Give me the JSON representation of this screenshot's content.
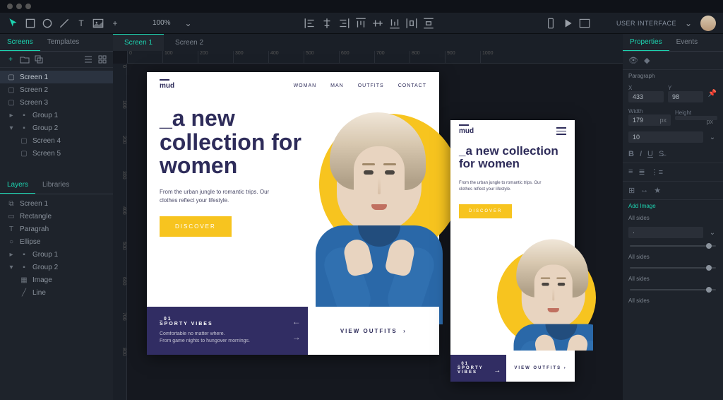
{
  "zoom": "100%",
  "user_label": "USER INTERFACE",
  "screens_panel": {
    "tabs": [
      "Screens",
      "Templates"
    ],
    "items": [
      {
        "label": "Screen 1",
        "selected": true
      },
      {
        "label": "Screen 2"
      },
      {
        "label": "Screen 3"
      },
      {
        "label": "Group 1",
        "folder": true
      },
      {
        "label": "Group 2",
        "folder": true,
        "open": true
      },
      {
        "label": "Screen 4",
        "indent": 1
      },
      {
        "label": "Screen 5",
        "indent": 1
      }
    ]
  },
  "layers_panel": {
    "tabs": [
      "Layers",
      "Libraries"
    ],
    "items": [
      {
        "label": "Screen 1",
        "icon": "screen"
      },
      {
        "label": "Rectangle",
        "icon": "rect"
      },
      {
        "label": "Paragrah",
        "icon": "text"
      },
      {
        "label": "Ellipse",
        "icon": "ellipse"
      },
      {
        "label": "Group 1",
        "folder": true
      },
      {
        "label": "Group 2",
        "folder": true,
        "open": true
      },
      {
        "label": "Image",
        "indent": 1,
        "icon": "image"
      },
      {
        "label": "Line",
        "indent": 1,
        "icon": "line"
      }
    ]
  },
  "canvas_tabs": [
    "Screen 1",
    "Screen 2"
  ],
  "properties": {
    "tabs": [
      "Properties",
      "Events"
    ],
    "selection": "Paragraph",
    "x_label": "X",
    "x": "433",
    "y_label": "Y",
    "y": "98",
    "w_label": "Width",
    "w": "179",
    "w_unit": "px",
    "h_label": "Height",
    "h": "",
    "h_unit": "px",
    "fontsize": "10",
    "add_image": "Add Image",
    "sides": "All sides"
  },
  "design": {
    "logo": "mud",
    "nav": [
      "WOMAN",
      "MAN",
      "OUTFITS",
      "CONTACT"
    ],
    "headline": "_a new collection for women",
    "sub": "From the urban jungle to romantic trips. Our clothes reflect your lifestyle.",
    "cta": "DISCOVER",
    "kicker_no": "_01",
    "kicker": "SPORTY VIBES",
    "kicker_desc1": "Comfortable no matter where.",
    "kicker_desc2": "From game nights to hungover mornings.",
    "view_outfits": "VIEW OUTFITS",
    "mobile_kicker": "SPORTY VIBES"
  }
}
